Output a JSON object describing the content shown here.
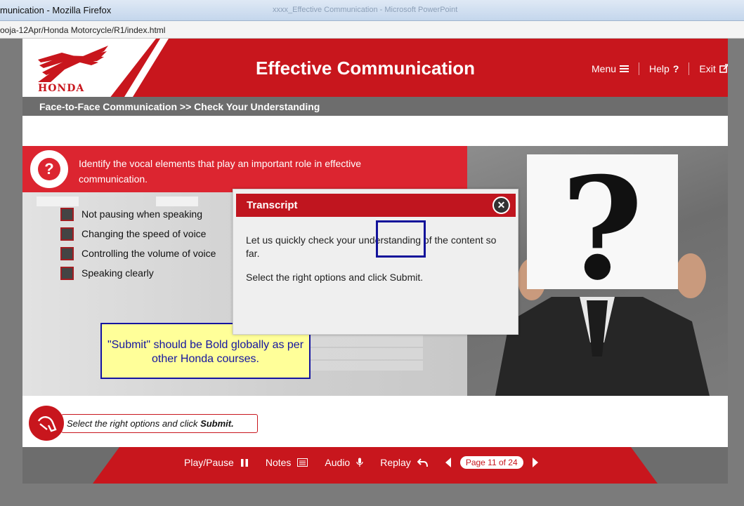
{
  "browser": {
    "title": "munication - Mozilla Firefox",
    "ghost_title": "xxxx_Effective Communication - Microsoft PowerPoint",
    "url": "ooja-12Apr/Honda Motorcycle/R1/index.html"
  },
  "header": {
    "logo_text": "HONDA",
    "course_title": "Effective Communication",
    "nav": {
      "menu": "Menu",
      "help": "Help",
      "exit": "Exit"
    }
  },
  "breadcrumb": "Face-to-Face Communication >> Check Your Understanding",
  "question": {
    "text": "Identify the vocal elements that play an important role in effective communication.",
    "options": [
      "Not pausing when speaking",
      "Changing the speed of voice",
      "Controlling the volume of voice",
      "Speaking clearly"
    ]
  },
  "transcript": {
    "title": "Transcript",
    "paragraph1": "Let us quickly check your understanding of the content so far.",
    "paragraph2": "Select the right options and click Submit."
  },
  "annotation": "\"Submit\" should be Bold globally as per other Honda courses.",
  "instruction": {
    "prefix": "Select the right options and click ",
    "emph": "Submit."
  },
  "footer": {
    "play_pause": "Play/Pause",
    "notes": "Notes",
    "audio": "Audio",
    "replay": "Replay",
    "page": "Page 11 of 24"
  },
  "colors": {
    "brand_red": "#c8161d",
    "bar_red": "#dc2530",
    "footer_gray": "#6d6d6d"
  }
}
